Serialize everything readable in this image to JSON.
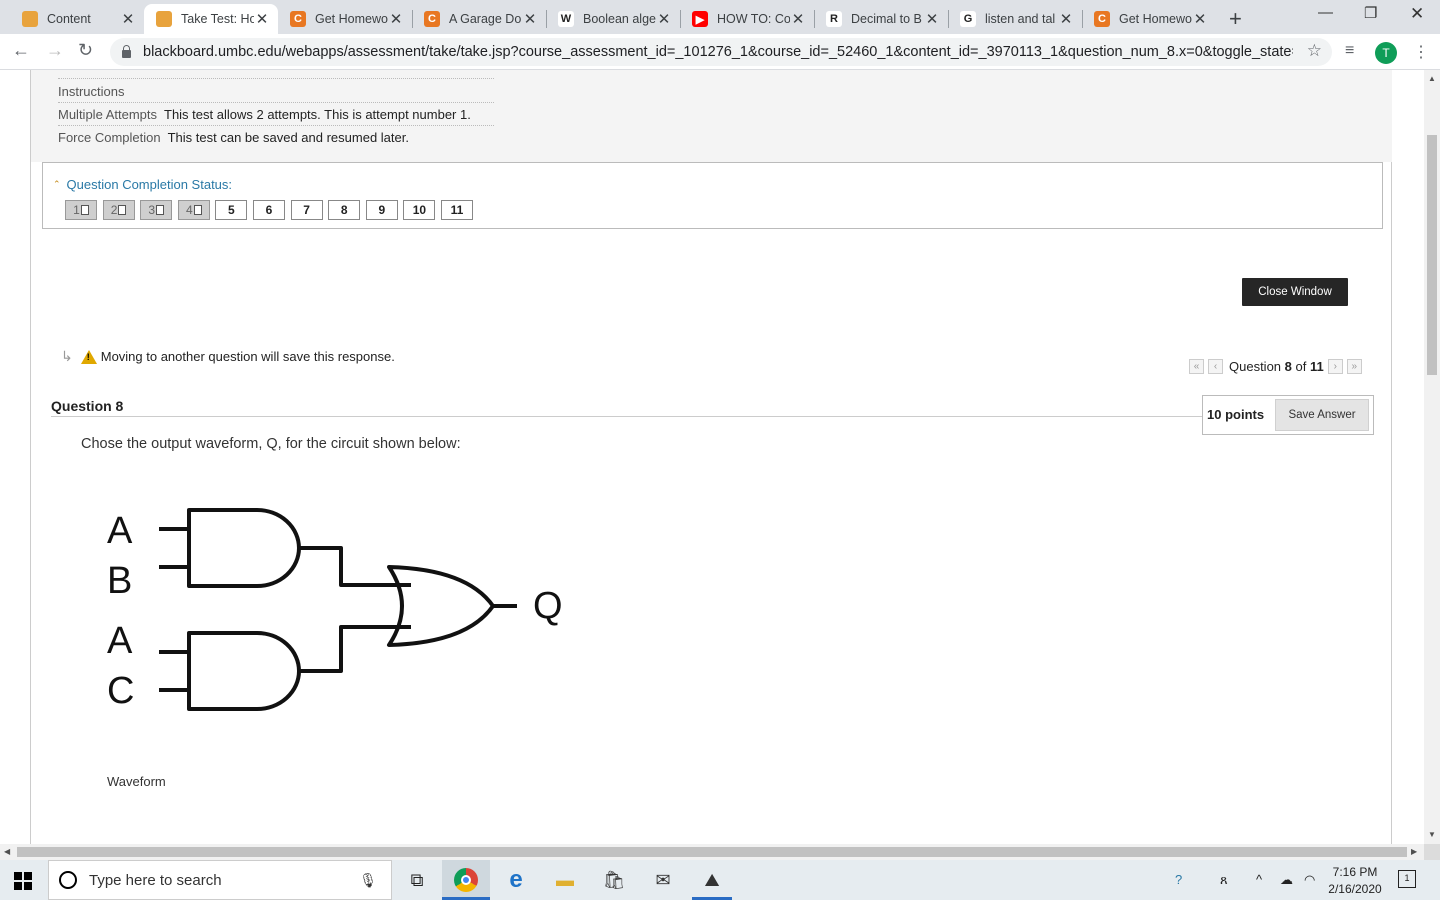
{
  "browser": {
    "tabs": [
      {
        "title": "Content",
        "favicon": "blackboard-icon",
        "color": "#e8a33d",
        "glyph": ""
      },
      {
        "title": "Take Test: Ho",
        "favicon": "blackboard-icon",
        "color": "#e8a33d",
        "glyph": "",
        "active": true
      },
      {
        "title": "Get Homewo",
        "favicon": "chegg-icon",
        "color": "#e87722",
        "glyph": "C"
      },
      {
        "title": "A Garage Do",
        "favicon": "chegg-icon",
        "color": "#e87722",
        "glyph": "C"
      },
      {
        "title": "Boolean alge",
        "favicon": "wikipedia-icon",
        "color": "#ffffff",
        "glyph": "W"
      },
      {
        "title": "HOW TO: Co",
        "favicon": "youtube-icon",
        "color": "#ff0000",
        "glyph": "▶"
      },
      {
        "title": "Decimal to B",
        "favicon": "rapidtables-icon",
        "color": "#ffffff",
        "glyph": "R"
      },
      {
        "title": "listen and tal",
        "favicon": "google-icon",
        "color": "#ffffff",
        "glyph": "G"
      },
      {
        "title": "Get Homewo",
        "favicon": "chegg-icon",
        "color": "#e87722",
        "glyph": "C"
      }
    ],
    "url": "blackboard.umbc.edu/webapps/assessment/take/take.jsp?course_assessment_id=_101276_1&course_id=_52460_1&content_id=_3970113_1&question_num_8.x=0&toggle_state=qShow...",
    "profile_initial": "T"
  },
  "test_info": {
    "instructions_label": "Instructions",
    "multiple_attempts_label": "Multiple Attempts",
    "multiple_attempts_value": "This test allows 2 attempts. This is attempt number 1.",
    "force_completion_label": "Force Completion",
    "force_completion_value": "This test can be saved and resumed later."
  },
  "completion": {
    "title": "Question Completion Status:",
    "questions": [
      {
        "num": "1",
        "answered": true
      },
      {
        "num": "2",
        "answered": true
      },
      {
        "num": "3",
        "answered": true
      },
      {
        "num": "4",
        "answered": true
      },
      {
        "num": "5",
        "answered": false
      },
      {
        "num": "6",
        "answered": false
      },
      {
        "num": "7",
        "answered": false
      },
      {
        "num": "8",
        "answered": false
      },
      {
        "num": "9",
        "answered": false
      },
      {
        "num": "10",
        "answered": false
      },
      {
        "num": "11",
        "answered": false
      }
    ]
  },
  "close_window_label": "Close Window",
  "move_note": "Moving to another question will save this response.",
  "question_nav": {
    "prefix": "Question",
    "current": "8",
    "of": "of",
    "total": "11"
  },
  "question": {
    "heading": "Question 8",
    "points": "10 points",
    "save_label": "Save Answer",
    "text": "Chose the output waveform, Q, for the circuit shown below:",
    "circuit_inputs": [
      "A",
      "B",
      "A",
      "C"
    ],
    "circuit_output": "Q",
    "waveform_label": "Waveform"
  },
  "taskbar": {
    "search_placeholder": "Type here to search",
    "time": "7:16 PM",
    "date": "2/16/2020",
    "notification_count": "1"
  }
}
